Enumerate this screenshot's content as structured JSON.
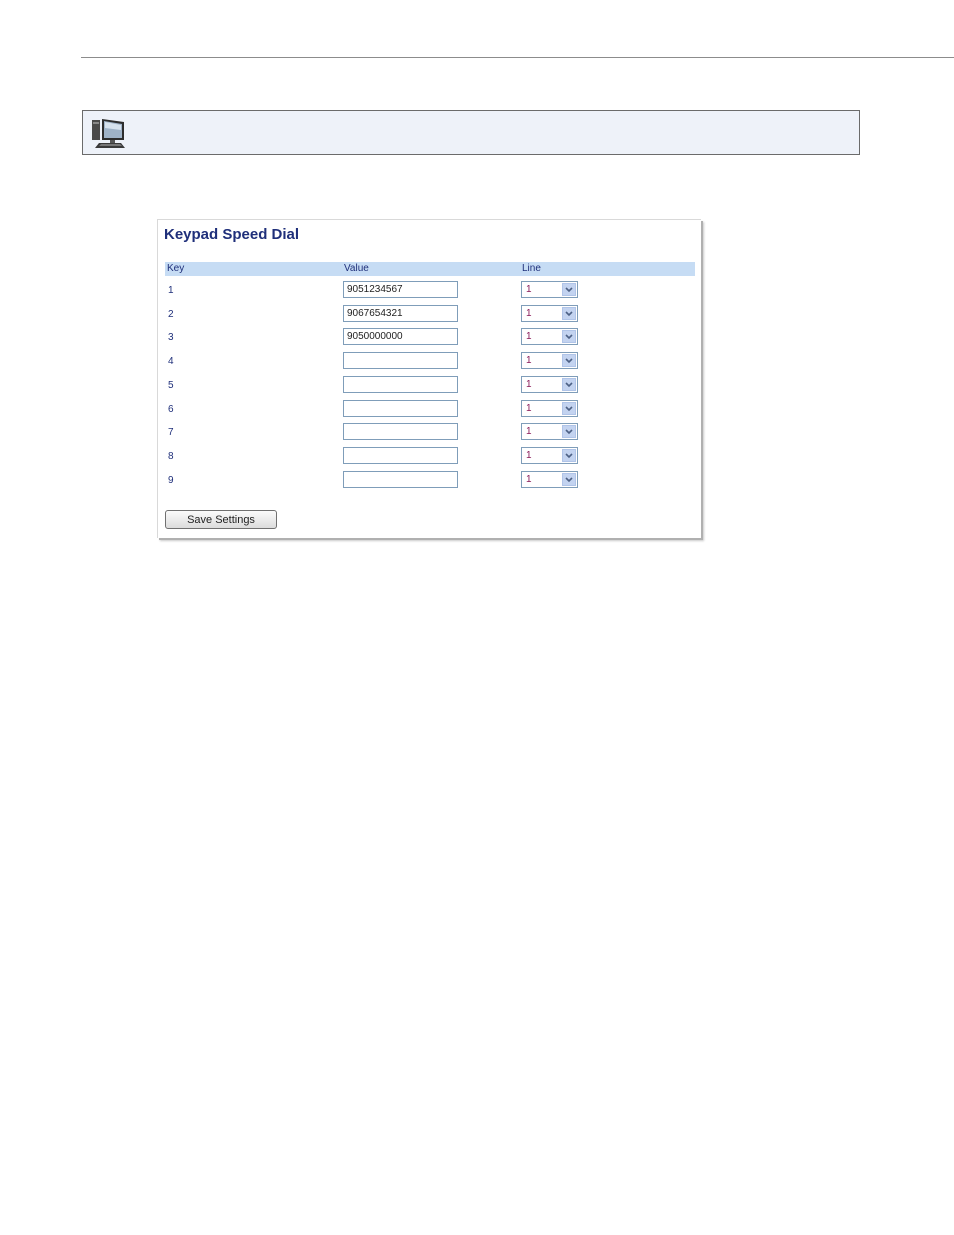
{
  "panel": {
    "title": "Keypad Speed Dial",
    "columns": {
      "key": "Key",
      "value": "Value",
      "line": "Line"
    },
    "rows": [
      {
        "key": "1",
        "value": "9051234567",
        "line": "1"
      },
      {
        "key": "2",
        "value": "9067654321",
        "line": "1"
      },
      {
        "key": "3",
        "value": "9050000000",
        "line": "1"
      },
      {
        "key": "4",
        "value": "",
        "line": "1"
      },
      {
        "key": "5",
        "value": "",
        "line": "1"
      },
      {
        "key": "6",
        "value": "",
        "line": "1"
      },
      {
        "key": "7",
        "value": "",
        "line": "1"
      },
      {
        "key": "8",
        "value": "",
        "line": "1"
      },
      {
        "key": "9",
        "value": "",
        "line": "1"
      }
    ],
    "save_label": "Save Settings"
  },
  "banner": {
    "icon": "computer-monitor-icon"
  },
  "colors": {
    "title": "#1f2f7a",
    "header_bg": "#c6dcf4",
    "banner_bg": "#eef2f9"
  }
}
